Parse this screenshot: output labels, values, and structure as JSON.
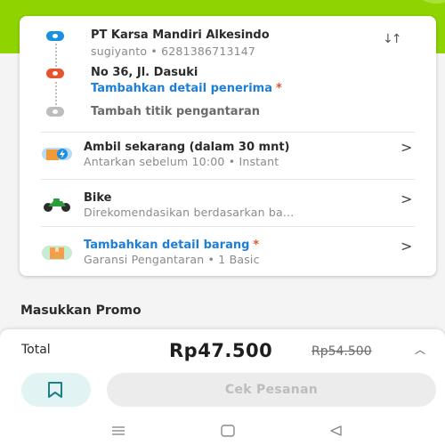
{
  "colors": {
    "header_green": "#8fd400",
    "pickup_dot": "#1e8fe0",
    "dropoff_dot": "#e9522f",
    "add_stop_dot": "#bdbdbd",
    "link_blue": "#1e7fd6",
    "required_red": "#e9522f",
    "button_disabled_bg": "#ececec",
    "bookmark_bg": "#e2f3f3"
  },
  "route": {
    "pickup": {
      "name": "PT Karsa Mandiri Alkesindo",
      "contact": "sugiyanto • 6281386713147"
    },
    "dropoff": {
      "address": "No 36, Jl. Dasuki",
      "add_receiver_label": "Tambahkan detail penerima",
      "required_mark": "*"
    },
    "add_stop_label": "Tambah titik pengantaran",
    "swap_icon": "swap-vertical-icon"
  },
  "options": [
    {
      "icon": "box-lightning-icon",
      "title": "Ambil sekarang (dalam 30 mnt)",
      "subtitle": "Antarkan sebelum 10:00 • Instant"
    },
    {
      "icon": "motorbike-icon",
      "title": "Bike",
      "subtitle": "Direkomendasikan berdasarkan ba..."
    },
    {
      "icon": "package-icon",
      "title": "Tambahkan detail barang",
      "required_mark": "*",
      "subtitle": "Garansi Pengantaran • 1 Basic"
    }
  ],
  "promo": {
    "title": "Masukkan Promo"
  },
  "summary": {
    "total_label": "Total",
    "price": "Rp47.500",
    "original_price": "Rp54.500",
    "cta_label": "Cek Pesanan",
    "cta_enabled": false,
    "bookmark_icon": "bookmark-icon"
  },
  "navbar": {
    "icons": [
      "recents-icon",
      "home-icon",
      "back-icon"
    ]
  }
}
